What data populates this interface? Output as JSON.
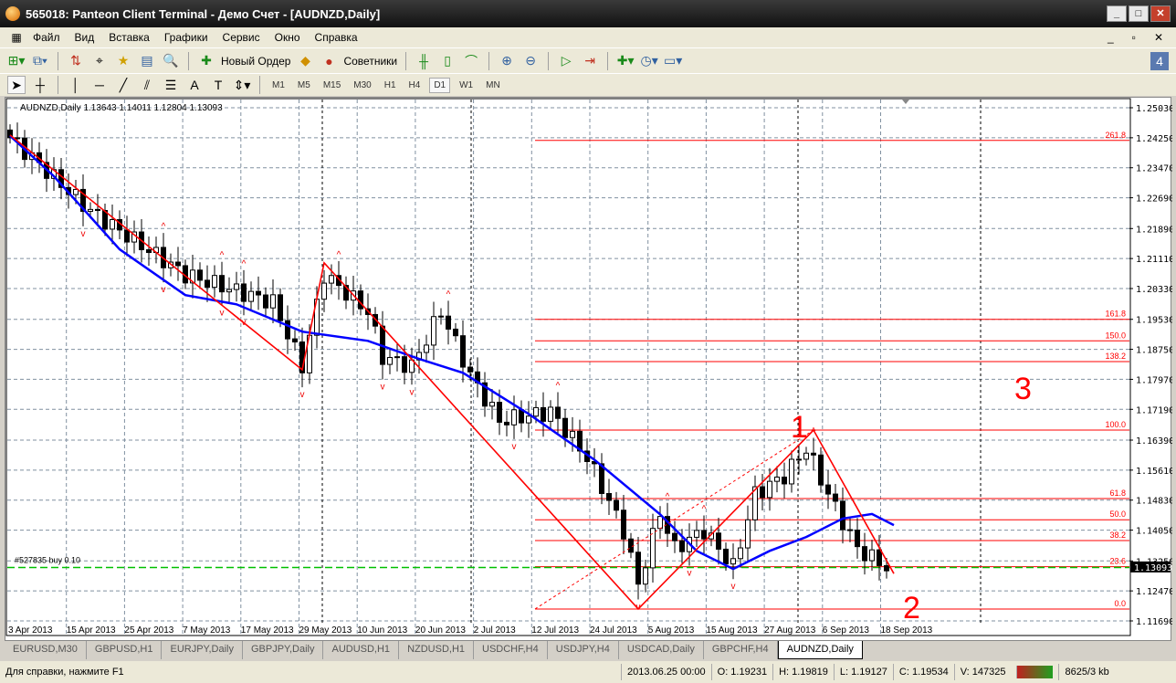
{
  "window": {
    "title": "565018: Panteon Client Terminal - Демо Счет - [AUDNZD,Daily]"
  },
  "menu": [
    "Файл",
    "Вид",
    "Вставка",
    "Графики",
    "Сервис",
    "Окно",
    "Справка"
  ],
  "toolbar": {
    "new_order": "Новый Ордер",
    "experts": "Советники"
  },
  "timeframes": [
    "M1",
    "M5",
    "M15",
    "M30",
    "H1",
    "H4",
    "D1",
    "W1",
    "MN"
  ],
  "active_timeframe": "D1",
  "chart": {
    "header": "AUDNZD,Daily  1.13643 1.14011 1.12804 1.13093",
    "order_label": "#527835 buy 0.10",
    "current_price": "1.13093",
    "price_ticks": [
      "1.25030",
      "1.24250",
      "1.23470",
      "1.22690",
      "1.21890",
      "1.21110",
      "1.20330",
      "1.19530",
      "1.18750",
      "1.17970",
      "1.17190",
      "1.16390",
      "1.15610",
      "1.14830",
      "1.14050",
      "1.13250",
      "1.12470",
      "1.11690"
    ],
    "date_ticks": [
      "3 Apr 2013",
      "15 Apr 2013",
      "25 Apr 2013",
      "7 May 2013",
      "17 May 2013",
      "29 May 2013",
      "10 Jun 2013",
      "20 Jun 2013",
      "2 Jul 2013",
      "12 Jul 2013",
      "24 Jul 2013",
      "5 Aug 2013",
      "15 Aug 2013",
      "27 Aug 2013",
      "6 Sep 2013",
      "18 Sep 2013"
    ],
    "fib_levels": [
      {
        "label": "261.8",
        "price": 1.2418
      },
      {
        "label": "161.8",
        "price": 1.1953
      },
      {
        "label": "150.0",
        "price": 1.1897
      },
      {
        "label": "138.2",
        "price": 1.1843
      },
      {
        "label": "100.0",
        "price": 1.1665
      },
      {
        "label": "61.8",
        "price": 1.1487
      },
      {
        "label": "50.0",
        "price": 1.1432
      },
      {
        "label": "38.2",
        "price": 1.1378
      },
      {
        "label": "23.6",
        "price": 1.131
      },
      {
        "label": "0.0",
        "price": 1.12
      }
    ],
    "annotations": [
      "1",
      "2",
      "3"
    ],
    "colors": {
      "bull": "#ffffff",
      "bear": "#000000",
      "ma": "#0000ff",
      "zigzag": "#ff0000",
      "fib": "#ff0000",
      "order": "#00c000"
    }
  },
  "chart_data": {
    "type": "candlestick",
    "trend_anchors": [
      [
        0,
        1.2425
      ],
      [
        11,
        1.2235
      ],
      [
        24,
        1.2069
      ],
      [
        36,
        1.1997
      ],
      [
        40,
        1.1831
      ],
      [
        43,
        1.2069
      ],
      [
        49,
        1.1974
      ],
      [
        51,
        1.1855
      ],
      [
        55,
        1.1831
      ],
      [
        59,
        1.1974
      ],
      [
        63,
        1.1808
      ],
      [
        67,
        1.1689
      ],
      [
        74,
        1.1713
      ],
      [
        79,
        1.1594
      ],
      [
        84,
        1.1404
      ],
      [
        86,
        1.1262
      ],
      [
        89,
        1.1451
      ],
      [
        91,
        1.1357
      ],
      [
        95,
        1.1404
      ],
      [
        99,
        1.1309
      ],
      [
        102,
        1.1499
      ],
      [
        106,
        1.1546
      ],
      [
        109,
        1.1618
      ],
      [
        112,
        1.1499
      ],
      [
        116,
        1.1357
      ],
      [
        120,
        1.1309
      ]
    ],
    "ma": [
      [
        0,
        1.243
      ],
      [
        6,
        1.2325
      ],
      [
        15,
        1.2135
      ],
      [
        24,
        1.2016
      ],
      [
        31,
        1.1992
      ],
      [
        40,
        1.1921
      ],
      [
        49,
        1.1897
      ],
      [
        56,
        1.185
      ],
      [
        62,
        1.1814
      ],
      [
        71,
        1.1707
      ],
      [
        80,
        1.1588
      ],
      [
        89,
        1.1446
      ],
      [
        94,
        1.1351
      ],
      [
        99,
        1.1304
      ],
      [
        104,
        1.1351
      ],
      [
        109,
        1.1387
      ],
      [
        114,
        1.1435
      ],
      [
        118,
        1.1447
      ],
      [
        121,
        1.1418
      ]
    ],
    "zigzag": [
      [
        0,
        1.2432
      ],
      [
        40,
        1.1822
      ],
      [
        43,
        1.21
      ],
      [
        86,
        1.12
      ],
      [
        110,
        1.1665
      ],
      [
        121,
        1.1292
      ]
    ]
  },
  "tabs": [
    "EURUSD,M30",
    "GBPUSD,H1",
    "EURJPY,Daily",
    "GBPJPY,Daily",
    "AUDUSD,H1",
    "NZDUSD,H1",
    "USDCHF,H4",
    "USDJPY,H4",
    "USDCAD,Daily",
    "GBPCHF,H4",
    "AUDNZD,Daily"
  ],
  "status": {
    "help": "Для справки, нажмите F1",
    "time": "2013.06.25 00:00",
    "open": "O: 1.19231",
    "high": "H: 1.19819",
    "low": "L: 1.19127",
    "close": "C: 1.19534",
    "volume": "V: 147325",
    "traffic": "8625/3 kb"
  }
}
